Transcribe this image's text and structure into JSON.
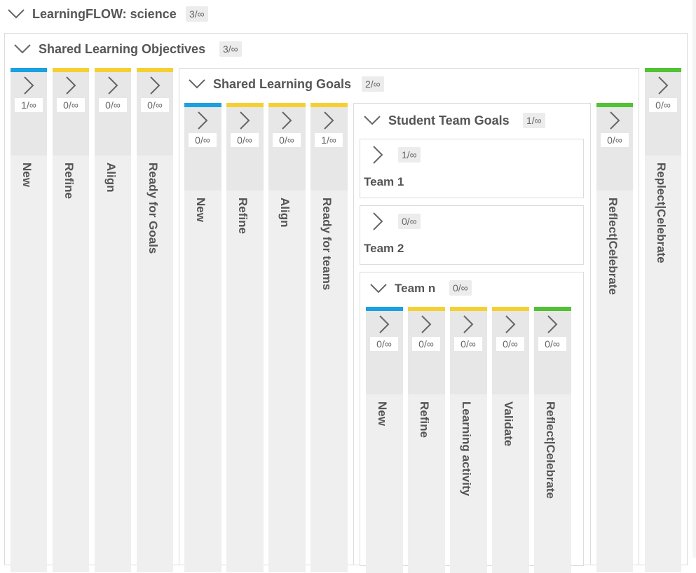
{
  "colors": {
    "new": "#1ba1e2",
    "in_progress": "#f5d033",
    "done": "#52c234"
  },
  "icons": {
    "collapse": "chevron-down-icon",
    "expand": "chevron-right-icon"
  },
  "board": {
    "title": "LearningFLOW: science",
    "count": "3/∞",
    "objectives": {
      "title": "Shared Learning Objectives",
      "count": "3/∞",
      "columns": [
        {
          "label": "New",
          "count": "1/∞",
          "status": "new"
        },
        {
          "label": "Refine",
          "count": "0/∞",
          "status": "in_progress"
        },
        {
          "label": "Align",
          "count": "0/∞",
          "status": "in_progress"
        },
        {
          "label": "Ready for Goals",
          "count": "0/∞",
          "status": "in_progress"
        },
        {
          "label": "Replect|Celebrate",
          "count": "0/∞",
          "status": "done"
        }
      ],
      "goals": {
        "title": "Shared Learning Goals",
        "count": "2/∞",
        "columns": [
          {
            "label": "New",
            "count": "0/∞",
            "status": "new"
          },
          {
            "label": "Refine",
            "count": "0/∞",
            "status": "in_progress"
          },
          {
            "label": "Align",
            "count": "0/∞",
            "status": "in_progress"
          },
          {
            "label": "Ready for teams",
            "count": "1/∞",
            "status": "in_progress"
          },
          {
            "label": "Reflect|Celebrate",
            "count": "0/∞",
            "status": "done"
          }
        ],
        "student_team_goals": {
          "title": "Student Team Goals",
          "count": "1/∞",
          "teams": [
            {
              "name": "Team 1",
              "count": "1/∞"
            },
            {
              "name": "Team 2",
              "count": "0/∞"
            }
          ],
          "team_n": {
            "title": "Team n",
            "count": "0/∞",
            "columns": [
              {
                "label": "New",
                "count": "0/∞",
                "status": "new"
              },
              {
                "label": "Refine",
                "count": "0/∞",
                "status": "in_progress"
              },
              {
                "label": "Learning activity",
                "count": "0/∞",
                "status": "in_progress"
              },
              {
                "label": "Validate",
                "count": "0/∞",
                "status": "in_progress"
              },
              {
                "label": "Reflect|Celebrate",
                "count": "0/∞",
                "status": "done"
              }
            ]
          }
        }
      }
    }
  }
}
